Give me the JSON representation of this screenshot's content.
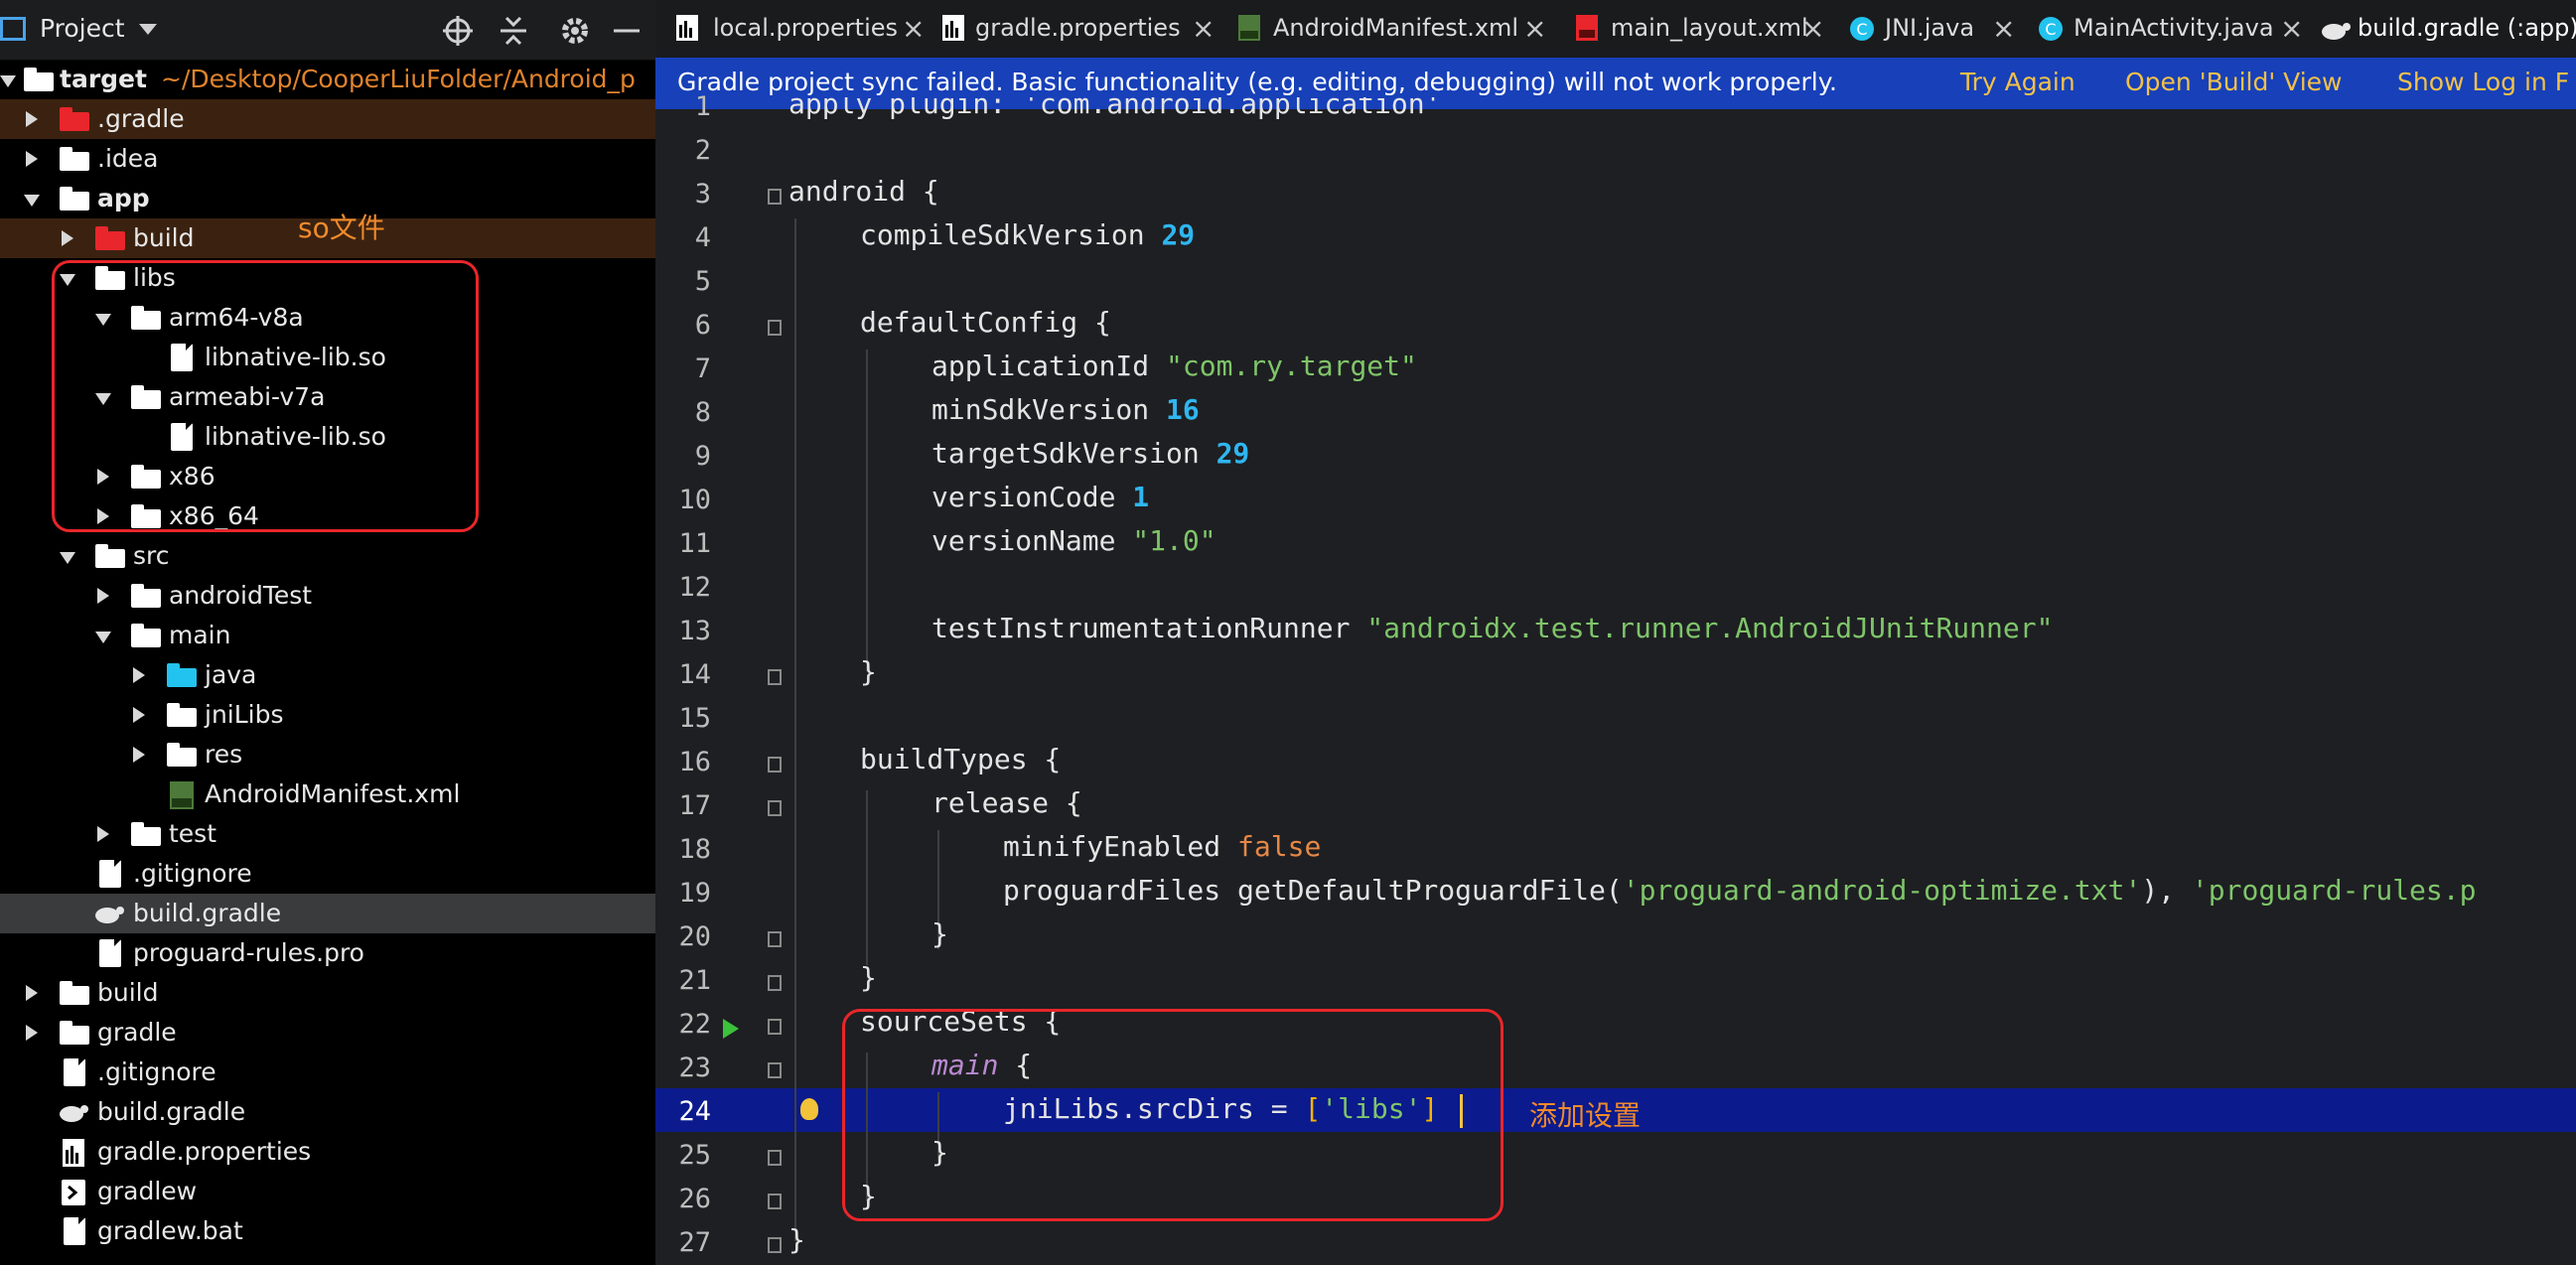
{
  "project_panel": {
    "title": "Project",
    "tree": [
      {
        "label": "target",
        "path": "~/Desktop/CooperLiuFolder/Android_p"
      },
      {
        "label": ".gradle"
      },
      {
        "label": ".idea"
      },
      {
        "label": "app"
      },
      {
        "label": "build"
      },
      {
        "label": "libs"
      },
      {
        "label": "arm64-v8a"
      },
      {
        "label": "libnative-lib.so"
      },
      {
        "label": "armeabi-v7a"
      },
      {
        "label": "libnative-lib.so"
      },
      {
        "label": "x86"
      },
      {
        "label": "x86_64"
      },
      {
        "label": "src"
      },
      {
        "label": "androidTest"
      },
      {
        "label": "main"
      },
      {
        "label": "java"
      },
      {
        "label": "jniLibs"
      },
      {
        "label": "res"
      },
      {
        "label": "AndroidManifest.xml"
      },
      {
        "label": "test"
      },
      {
        "label": ".gitignore"
      },
      {
        "label": "build.gradle"
      },
      {
        "label": "proguard-rules.pro"
      },
      {
        "label": "build"
      },
      {
        "label": "gradle"
      },
      {
        "label": ".gitignore"
      },
      {
        "label": "build.gradle"
      },
      {
        "label": "gradle.properties"
      },
      {
        "label": "gradlew"
      },
      {
        "label": "gradlew.bat"
      }
    ],
    "annotation": "so文件"
  },
  "tabs": [
    {
      "label": "local.properties",
      "icon": "properties-file-icon"
    },
    {
      "label": "gradle.properties",
      "icon": "properties-file-icon"
    },
    {
      "label": "AndroidManifest.xml",
      "icon": "manifest-file-icon"
    },
    {
      "label": "main_layout.xml",
      "icon": "layout-file-icon"
    },
    {
      "label": "JNI.java",
      "icon": "java-class-icon"
    },
    {
      "label": "MainActivity.java",
      "icon": "java-class-icon"
    },
    {
      "label": "build.gradle (:app)",
      "icon": "gradle-icon",
      "active": true
    }
  ],
  "banner": {
    "message": "Gradle project sync failed. Basic functionality (e.g. editing, debugging) will not work properly.",
    "try_again": "Try Again",
    "open_build": "Open 'Build' View",
    "show_log": "Show Log in F"
  },
  "editor": {
    "line_numbers": [
      "1",
      "2",
      "3",
      "4",
      "5",
      "6",
      "7",
      "8",
      "9",
      "10",
      "11",
      "12",
      "13",
      "14",
      "15",
      "16",
      "17",
      "18",
      "19",
      "20",
      "21",
      "22",
      "23",
      "24",
      "25",
      "26",
      "27"
    ],
    "current_line": "24",
    "annotation": "添加设置",
    "code": {
      "l1": "apply plugin: 'com.android.application'",
      "l3": "android {",
      "l4_a": "compileSdkVersion ",
      "l4_b": "29",
      "l6": "defaultConfig {",
      "l7_a": "applicationId ",
      "l7_b": "\"com.ry.target\"",
      "l8_a": "minSdkVersion ",
      "l8_b": "16",
      "l9_a": "targetSdkVersion ",
      "l9_b": "29",
      "l10_a": "versionCode ",
      "l10_b": "1",
      "l11_a": "versionName ",
      "l11_b": "\"1.0\"",
      "l13_a": "testInstrumentationRunner ",
      "l13_b": "\"androidx.test.runner.AndroidJUnitRunner\"",
      "l14": "}",
      "l16": "buildTypes {",
      "l17": "release {",
      "l18_a": "minifyEnabled ",
      "l18_b": "false",
      "l19_a": "proguardFiles getDefaultProguardFile(",
      "l19_b": "'proguard-android-optimize.txt'",
      "l19_c": "), ",
      "l19_d": "'proguard-rules.p",
      "l20": "}",
      "l21": "}",
      "l22": "sourceSets {",
      "l23_a": "main",
      "l23_b": " {",
      "l24_a": "jniLibs.srcDirs = ",
      "l24_b": "[",
      "l24_c": "'libs'",
      "l24_d": "]",
      "l25": "}",
      "l26": "}",
      "l27": "}"
    }
  },
  "colors": {
    "accent": "#4aa3e8",
    "banner_bg": "#1740b9",
    "annotation_box": "#e8262b",
    "annotation_text": "#f08a2c"
  }
}
